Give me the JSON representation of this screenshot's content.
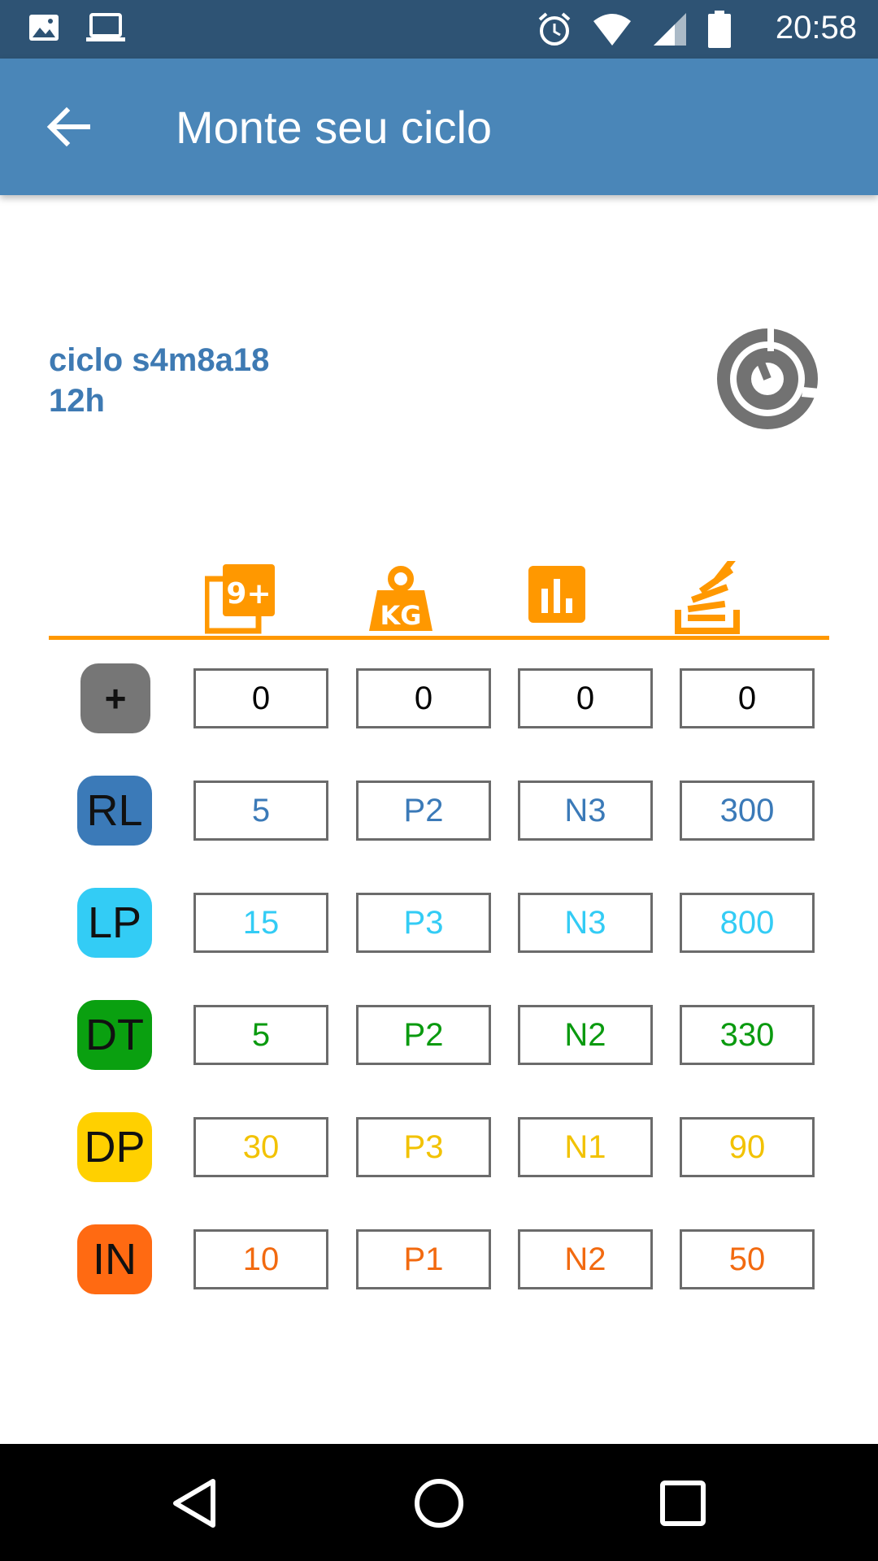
{
  "status_bar": {
    "time": "20:58",
    "icons": [
      "image-icon",
      "laptop-icon",
      "alarm-icon",
      "wifi-icon",
      "signal-icon",
      "battery-icon"
    ]
  },
  "app_bar": {
    "title": "Monte seu ciclo",
    "back_icon": "arrow-back-icon",
    "color": "#4a86b8"
  },
  "cycle": {
    "name": "ciclo s4m8a18",
    "duration": "12h",
    "icon": "cycle-icon"
  },
  "columns": {
    "icons": [
      "counter-9plus-icon",
      "weight-kg-icon",
      "bar-chart-icon",
      "stack-icon"
    ],
    "accent": "#ff9800"
  },
  "rows": [
    {
      "label": "+",
      "badge_color": "#767676",
      "text_color": "#000000",
      "values": [
        "0",
        "0",
        "0",
        "0"
      ]
    },
    {
      "label": "RL",
      "badge_color": "#3b7ab8",
      "text_color": "#3b7ab8",
      "values": [
        "5",
        "P2",
        "N3",
        "300"
      ]
    },
    {
      "label": "LP",
      "badge_color": "#33ccf5",
      "text_color": "#33ccf5",
      "values": [
        "15",
        "P3",
        "N3",
        "800"
      ]
    },
    {
      "label": "DT",
      "badge_color": "#0aa010",
      "text_color": "#0a9a0f",
      "values": [
        "5",
        "P2",
        "N2",
        "330"
      ]
    },
    {
      "label": "DP",
      "badge_color": "#ffd000",
      "text_color": "#f2c200",
      "values": [
        "30",
        "P3",
        "N1",
        "90"
      ]
    },
    {
      "label": "IN",
      "badge_color": "#ff6a12",
      "text_color": "#f26a10",
      "values": [
        "10",
        "P1",
        "N2",
        "50"
      ]
    }
  ],
  "nav_bar": {
    "icons": [
      "back-triangle-icon",
      "home-circle-icon",
      "recents-square-icon"
    ]
  }
}
